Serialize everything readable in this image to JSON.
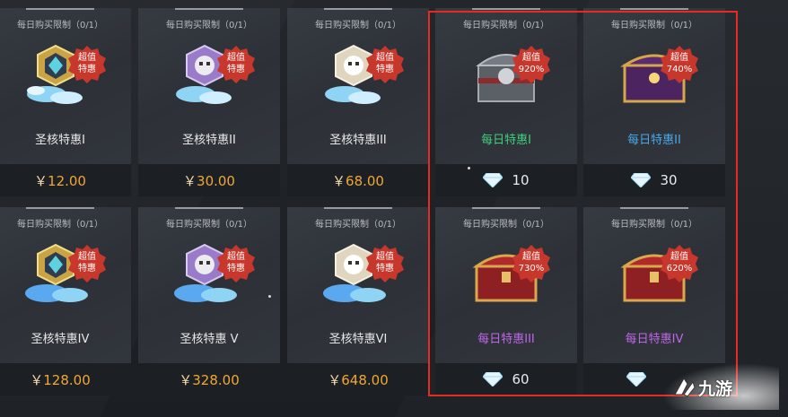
{
  "cards": [
    {
      "limit": "每日购买限制（0/1）",
      "badge1": "超值",
      "badge2": "特惠",
      "name": "圣核特惠I",
      "price_currency": "￥",
      "price": "12.00"
    },
    {
      "limit": "每日购买限制（0/1）",
      "badge1": "超值",
      "badge2": "特惠",
      "name": "圣核特惠II",
      "price_currency": "￥",
      "price": "30.00"
    },
    {
      "limit": "每日购买限制（0/1）",
      "badge1": "超值",
      "badge2": "特惠",
      "name": "圣核特惠III",
      "price_currency": "￥",
      "price": "68.00"
    },
    {
      "limit": "每日购买限制（0/1）",
      "badge1": "超值",
      "badge2": "920%",
      "name": "每日特惠I",
      "cost": "10"
    },
    {
      "limit": "每日购买限制（0/1）",
      "badge1": "超值",
      "badge2": "740%",
      "name": "每日特惠II",
      "cost": "30"
    },
    {
      "limit": "每日购买限制（0/1）",
      "badge1": "超值",
      "badge2": "特惠",
      "name": "圣核特惠IV",
      "price_currency": "￥",
      "price": "128.00"
    },
    {
      "limit": "每日购买限制（0/1）",
      "badge1": "超值",
      "badge2": "特惠",
      "name": "圣核特惠 V",
      "price_currency": "￥",
      "price": "328.00"
    },
    {
      "limit": "每日购买限制（0/1）",
      "badge1": "超值",
      "badge2": "特惠",
      "name": "圣核特惠VI",
      "price_currency": "￥",
      "price": "648.00"
    },
    {
      "limit": "每日购买限制（0/1）",
      "badge1": "超值",
      "badge2": "730%",
      "name": "每日特惠III",
      "cost": "60"
    },
    {
      "limit": "每日购买限制（0/1）",
      "badge1": "超值",
      "badge2": "620%",
      "name": "每日特惠IV",
      "cost": ""
    }
  ],
  "watermark": "九游",
  "colors": {
    "price": "#f0a733",
    "highlight": "#e52b22",
    "badge": "#c8372c",
    "daily_green": "#3fd07e",
    "daily_blue": "#4aa8ea",
    "daily_purple": "#c066ea"
  }
}
